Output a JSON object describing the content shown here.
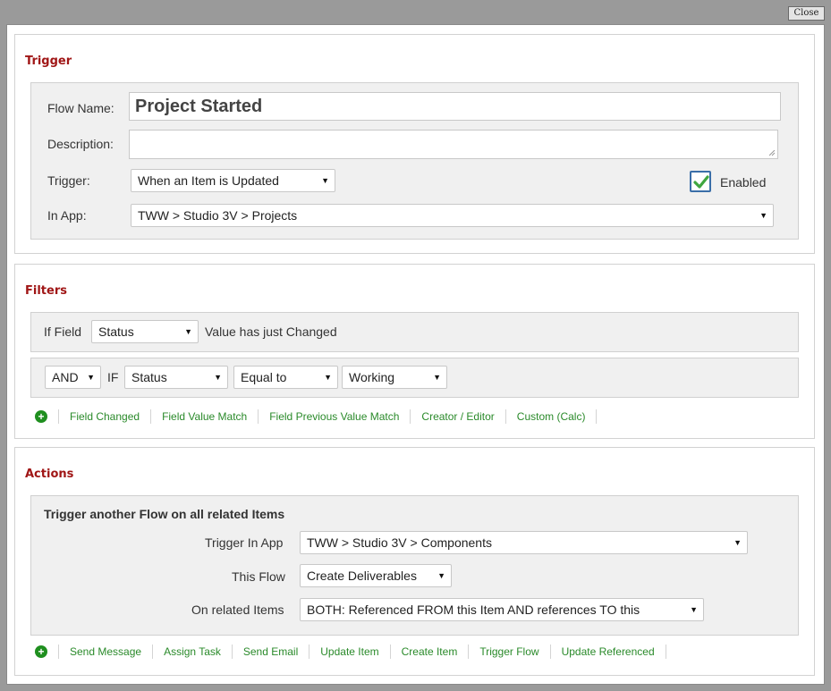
{
  "window": {
    "close_label": "Close"
  },
  "trigger": {
    "title": "Trigger",
    "flow_name_label": "Flow Name:",
    "flow_name_value": "Project Started",
    "description_label": "Description:",
    "description_value": "",
    "trigger_label": "Trigger:",
    "trigger_value": "When an Item is Updated",
    "enabled_label": "Enabled",
    "enabled_checked": true,
    "in_app_label": "In App:",
    "in_app_value": "TWW > Studio 3V > Projects"
  },
  "filters": {
    "title": "Filters",
    "row1": {
      "if_field_label": "If Field",
      "field_value": "Status",
      "suffix": "Value has just Changed"
    },
    "row2": {
      "operator_value": "AND",
      "if_label": "IF",
      "field_value": "Status",
      "comparison_value": "Equal to",
      "match_value": "Working"
    },
    "links": [
      "Field Changed",
      "Field Value Match",
      "Field Previous Value Match",
      "Creator / Editor",
      "Custom (Calc)"
    ]
  },
  "actions": {
    "title": "Actions",
    "action_title": "Trigger another Flow on all related Items",
    "trigger_in_app_label": "Trigger In App",
    "trigger_in_app_value": "TWW > Studio 3V > Components",
    "this_flow_label": "This Flow",
    "this_flow_value": "Create Deliverables",
    "related_label": "On related Items",
    "related_value": "BOTH: Referenced FROM this Item AND references TO this",
    "links": [
      "Send Message",
      "Assign Task",
      "Send Email",
      "Update Item",
      "Create Item",
      "Trigger Flow",
      "Update Referenced"
    ]
  },
  "icons": {
    "plus": "plus-circle-icon",
    "dropdown": "chevron-down-icon",
    "check": "checkmark-icon"
  },
  "colors": {
    "section_title": "#a01616",
    "link": "#2a8a2a",
    "plus": "#1f8f1f",
    "checkmark": "#3fa63f"
  }
}
